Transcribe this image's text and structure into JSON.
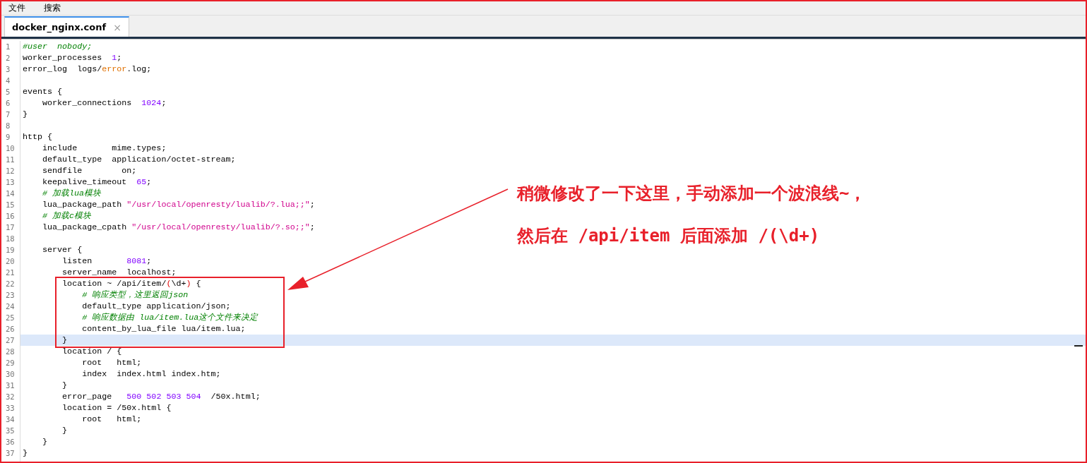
{
  "menu": [
    {
      "label": "文件"
    },
    {
      "label": "搜索"
    }
  ],
  "tabs": [
    {
      "label": "docker_nginx.conf",
      "selected": true,
      "close": "×"
    }
  ],
  "editor": {
    "lines": [
      {
        "number": "1",
        "current": false,
        "tokens": [
          {
            "kind": "comment",
            "text": "#user  nobody;"
          }
        ]
      },
      {
        "number": "2",
        "current": false,
        "tokens": [
          {
            "kind": "plain",
            "text": "worker_processes  "
          },
          {
            "kind": "number",
            "text": "1"
          },
          {
            "kind": "plain",
            "text": ";"
          }
        ]
      },
      {
        "number": "3",
        "current": false,
        "tokens": [
          {
            "kind": "plain",
            "text": "error_log  logs/"
          },
          {
            "kind": "keyword",
            "text": "error"
          },
          {
            "kind": "plain",
            "text": ".log;"
          }
        ]
      },
      {
        "number": "4",
        "current": false
      },
      {
        "number": "5",
        "current": false,
        "tokens": [
          {
            "kind": "plain",
            "text": "events {"
          }
        ]
      },
      {
        "number": "6",
        "current": false,
        "tokens": [
          {
            "kind": "plain",
            "text": "    worker_connections  "
          },
          {
            "kind": "number",
            "text": "1024"
          },
          {
            "kind": "plain",
            "text": ";"
          }
        ]
      },
      {
        "number": "7",
        "current": false,
        "tokens": [
          {
            "kind": "plain",
            "text": "}"
          }
        ]
      },
      {
        "number": "8",
        "current": false
      },
      {
        "number": "9",
        "current": false,
        "tokens": [
          {
            "kind": "plain",
            "text": "http {"
          }
        ]
      },
      {
        "number": "10",
        "current": false,
        "tokens": [
          {
            "kind": "plain",
            "text": "    include       mime.types;"
          }
        ]
      },
      {
        "number": "11",
        "current": false,
        "tokens": [
          {
            "kind": "plain",
            "text": "    default_type  application/octet-stream;"
          }
        ]
      },
      {
        "number": "12",
        "current": false,
        "tokens": [
          {
            "kind": "plain",
            "text": "    sendfile        on;"
          }
        ]
      },
      {
        "number": "13",
        "current": false,
        "tokens": [
          {
            "kind": "plain",
            "text": "    keepalive_timeout  "
          },
          {
            "kind": "number",
            "text": "65"
          },
          {
            "kind": "plain",
            "text": ";"
          }
        ]
      },
      {
        "number": "14",
        "current": false,
        "tokens": [
          {
            "kind": "comment",
            "text": "    # 加载lua模块"
          }
        ]
      },
      {
        "number": "15",
        "current": false,
        "tokens": [
          {
            "kind": "plain",
            "text": "    lua_package_path "
          },
          {
            "kind": "string",
            "text": "\"/usr/local/openresty/lualib/?.lua;;\""
          },
          {
            "kind": "plain",
            "text": ";"
          }
        ]
      },
      {
        "number": "16",
        "current": false,
        "tokens": [
          {
            "kind": "comment",
            "text": "    # 加载c模块"
          }
        ]
      },
      {
        "number": "17",
        "current": false,
        "tokens": [
          {
            "kind": "plain",
            "text": "    lua_package_cpath "
          },
          {
            "kind": "string",
            "text": "\"/usr/local/openresty/lualib/?.so;;\""
          },
          {
            "kind": "plain",
            "text": ";"
          }
        ]
      },
      {
        "number": "18",
        "current": false
      },
      {
        "number": "19",
        "current": false,
        "tokens": [
          {
            "kind": "plain",
            "text": "    server {"
          }
        ]
      },
      {
        "number": "20",
        "current": false,
        "tokens": [
          {
            "kind": "plain",
            "text": "        listen       "
          },
          {
            "kind": "number",
            "text": "8081"
          },
          {
            "kind": "plain",
            "text": ";"
          }
        ]
      },
      {
        "number": "21",
        "current": false,
        "tokens": [
          {
            "kind": "plain",
            "text": "        server_name  localhost;"
          }
        ]
      },
      {
        "number": "22",
        "current": false,
        "tokens": [
          {
            "kind": "plain",
            "text": "        location ~ /api/item/"
          },
          {
            "kind": "paren",
            "text": "("
          },
          {
            "kind": "plain",
            "text": "\\d+"
          },
          {
            "kind": "paren",
            "text": ")"
          },
          {
            "kind": "plain",
            "text": " {"
          }
        ]
      },
      {
        "number": "23",
        "current": false,
        "tokens": [
          {
            "kind": "comment",
            "text": "            # 响应类型，这里返回json"
          }
        ]
      },
      {
        "number": "24",
        "current": false,
        "tokens": [
          {
            "kind": "plain",
            "text": "            default_type application/json;"
          }
        ]
      },
      {
        "number": "25",
        "current": false,
        "tokens": [
          {
            "kind": "comment",
            "text": "            # 响应数据由 lua/item.lua这个文件来决定"
          }
        ]
      },
      {
        "number": "26",
        "current": false,
        "tokens": [
          {
            "kind": "plain",
            "text": "            content_by_lua_file lua/item.lua;"
          }
        ]
      },
      {
        "number": "27",
        "current": true,
        "tokens": [
          {
            "kind": "plain",
            "text": "        }"
          }
        ]
      },
      {
        "number": "28",
        "current": false,
        "tokens": [
          {
            "kind": "plain",
            "text": "        location / {"
          }
        ]
      },
      {
        "number": "29",
        "current": false,
        "tokens": [
          {
            "kind": "plain",
            "text": "            root   html;"
          }
        ]
      },
      {
        "number": "30",
        "current": false,
        "tokens": [
          {
            "kind": "plain",
            "text": "            index  index.html index.htm;"
          }
        ]
      },
      {
        "number": "31",
        "current": false,
        "tokens": [
          {
            "kind": "plain",
            "text": "        }"
          }
        ]
      },
      {
        "number": "32",
        "current": false,
        "tokens": [
          {
            "kind": "plain",
            "text": "        error_page   "
          },
          {
            "kind": "number",
            "text": "500 502 503 504"
          },
          {
            "kind": "plain",
            "text": "  /50x.html;"
          }
        ]
      },
      {
        "number": "33",
        "current": false,
        "tokens": [
          {
            "kind": "plain",
            "text": "        location = /50x.html {"
          }
        ]
      },
      {
        "number": "34",
        "current": false,
        "tokens": [
          {
            "kind": "plain",
            "text": "            root   html;"
          }
        ]
      },
      {
        "number": "35",
        "current": false,
        "tokens": [
          {
            "kind": "plain",
            "text": "        }"
          }
        ]
      },
      {
        "number": "36",
        "current": false,
        "tokens": [
          {
            "kind": "plain",
            "text": "    }"
          }
        ]
      },
      {
        "number": "37",
        "current": false,
        "tokens": [
          {
            "kind": "plain",
            "text": "}"
          }
        ]
      }
    ]
  },
  "annotation": {
    "lines": [
      "稍微修改了一下这里，手动添加一个波浪线~，",
      "然后在 /api/item 后面添加 /(\\d+)"
    ]
  }
}
